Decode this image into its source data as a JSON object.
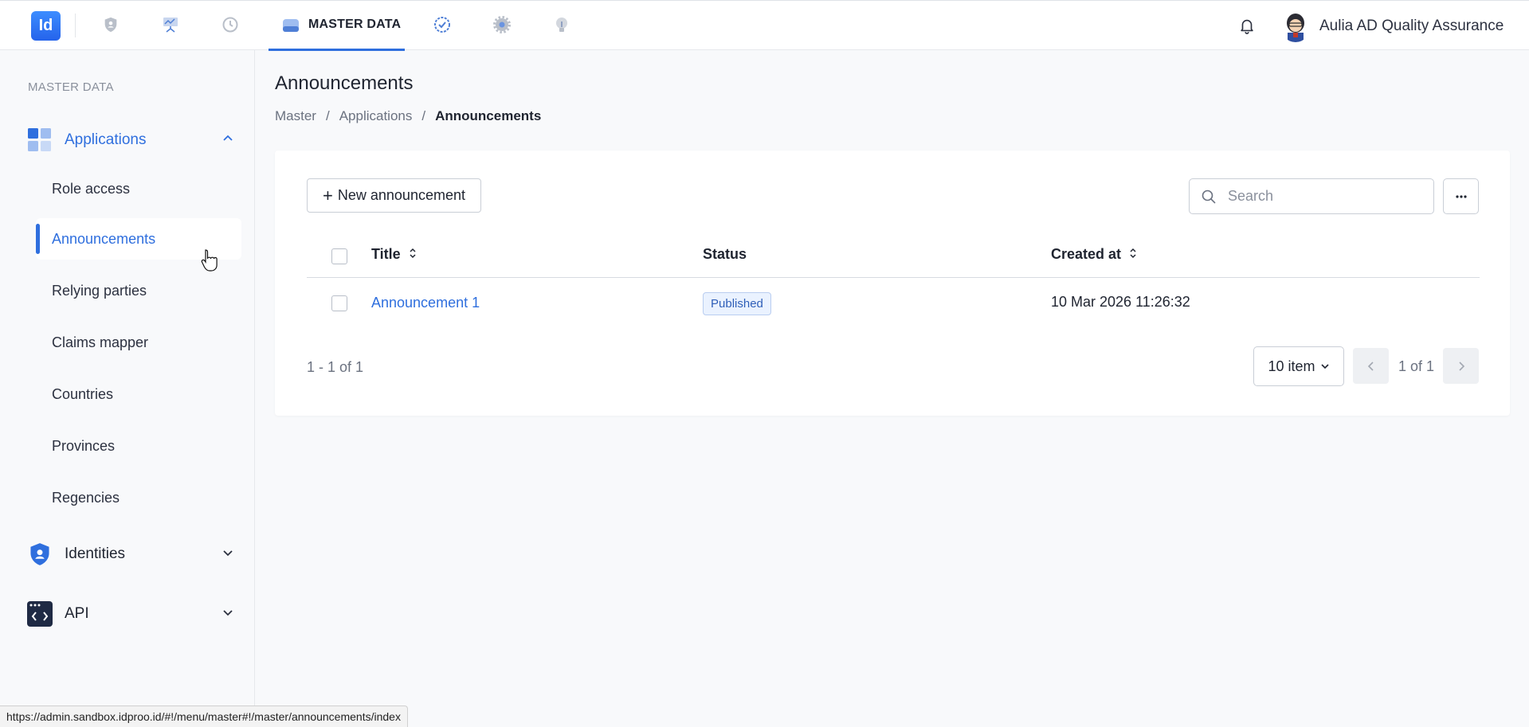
{
  "topbar": {
    "logo_text": "Id",
    "active_tab_label": "MASTER DATA",
    "user_name": "Aulia AD Quality Assurance",
    "icons": [
      "shield-icon",
      "presentation-icon",
      "history-icon",
      "database-icon",
      "badge-check-icon",
      "gear-icon",
      "bulb-icon",
      "bell-icon"
    ],
    "accent": "#2f6fde"
  },
  "sidebar": {
    "title": "MASTER DATA",
    "groups": [
      {
        "label": "Applications",
        "expanded": true
      },
      {
        "label": "Identities",
        "expanded": false
      },
      {
        "label": "API",
        "expanded": false
      }
    ],
    "items": [
      {
        "label": "Role access"
      },
      {
        "label": "Announcements",
        "active": true
      },
      {
        "label": "Relying parties"
      },
      {
        "label": "Claims mapper"
      },
      {
        "label": "Countries"
      },
      {
        "label": "Provinces"
      },
      {
        "label": "Regencies"
      }
    ]
  },
  "page": {
    "title": "Announcements",
    "breadcrumb": [
      "Master",
      "Applications",
      "Announcements"
    ]
  },
  "toolbar": {
    "new_label": "New announcement",
    "search_placeholder": "Search",
    "more_label": "···"
  },
  "table": {
    "columns": [
      "Title",
      "Status",
      "Created at"
    ],
    "rows": [
      {
        "title": "Announcement 1",
        "status": "Published",
        "created_at": "10 Mar 2026 11:26:32"
      }
    ]
  },
  "pagination": {
    "range_text": "1 - 1 of 1",
    "per_page": "10 item",
    "page_text": "1 of 1"
  },
  "statusbar": {
    "url": "https://admin.sandbox.idproo.id/#!/menu/master#!/master/announcements/index"
  }
}
